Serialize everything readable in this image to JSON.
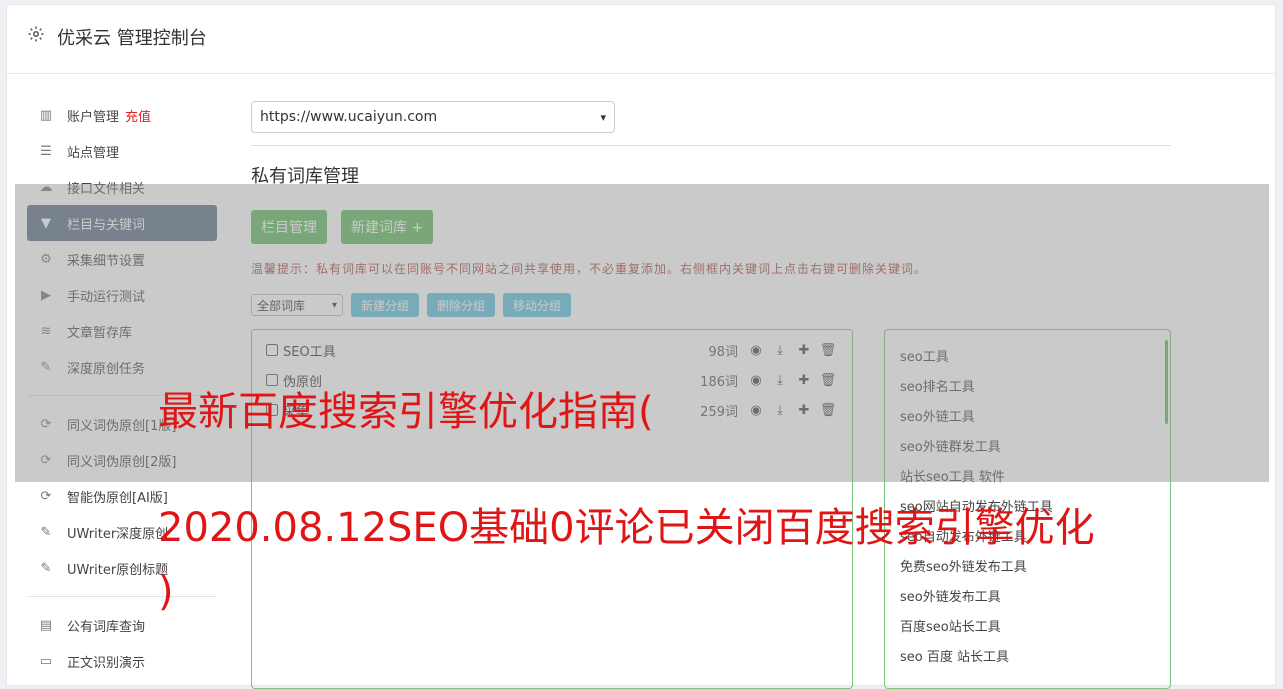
{
  "app": {
    "title": "优采云 管理控制台"
  },
  "sidebar": {
    "group1": [
      {
        "label": "账户管理",
        "icon": "bar-chart-icon",
        "badge": "充值"
      },
      {
        "label": "站点管理",
        "icon": "server-icon"
      },
      {
        "label": "接口文件相关",
        "icon": "cloud-upload-icon"
      },
      {
        "label": "栏目与关键词",
        "icon": "filter-icon",
        "active": true
      },
      {
        "label": "采集细节设置",
        "icon": "gears-icon"
      },
      {
        "label": "手动运行测试",
        "icon": "play-circle-icon"
      },
      {
        "label": "文章暂存库",
        "icon": "database-icon"
      },
      {
        "label": "深度原创任务",
        "icon": "edit-icon"
      }
    ],
    "group2": [
      {
        "label": "同义词伪原创[1版]",
        "icon": "refresh-icon"
      },
      {
        "label": "同义词伪原创[2版]",
        "icon": "refresh-icon"
      },
      {
        "label": "智能伪原创[AI版]",
        "icon": "refresh-icon"
      },
      {
        "label": "UWriter深度原创",
        "icon": "edit-icon"
      },
      {
        "label": "UWriter原创标题",
        "icon": "edit-icon"
      }
    ],
    "group3": [
      {
        "label": "公有词库查询",
        "icon": "book-icon"
      },
      {
        "label": "正文识别演示",
        "icon": "monitor-icon"
      }
    ]
  },
  "main": {
    "site_select": "https://www.ucaiyun.com",
    "section_title": "私有词库管理",
    "buttons": {
      "column_manage": "栏目管理",
      "new_library": "新建词库 +"
    },
    "tip": "温馨提示：私有词库可以在同账号不同网站之间共享使用，不必重复添加。右侧框内关键词上点击右键可删除关键词。",
    "filter_select": "全部词库",
    "group_buttons": {
      "new_group": "新建分组",
      "delete_group": "删除分组",
      "move_group": "移动分组"
    },
    "libraries": [
      {
        "name": "SEO工具",
        "count": "98词"
      },
      {
        "name": "伪原创",
        "count": "186词"
      },
      {
        "name": "采集",
        "count": "259词"
      }
    ],
    "keywords": [
      "seo工具",
      "seo排名工具",
      "seo外链工具",
      "seo外链群发工具",
      "站长seo工具 软件",
      "seo网站自动发布外链工具",
      "seo自动发布外链工具",
      "免费seo外链发布工具",
      "seo外链发布工具",
      "百度seo站长工具",
      "seo 百度 站长工具"
    ]
  },
  "overlay": {
    "headline_1": "最新百度搜索引擎优化指南(",
    "headline_2": "2020.08.12SEO基础0评论已关闭百度搜索引擎优化",
    "headline_3": ")"
  }
}
